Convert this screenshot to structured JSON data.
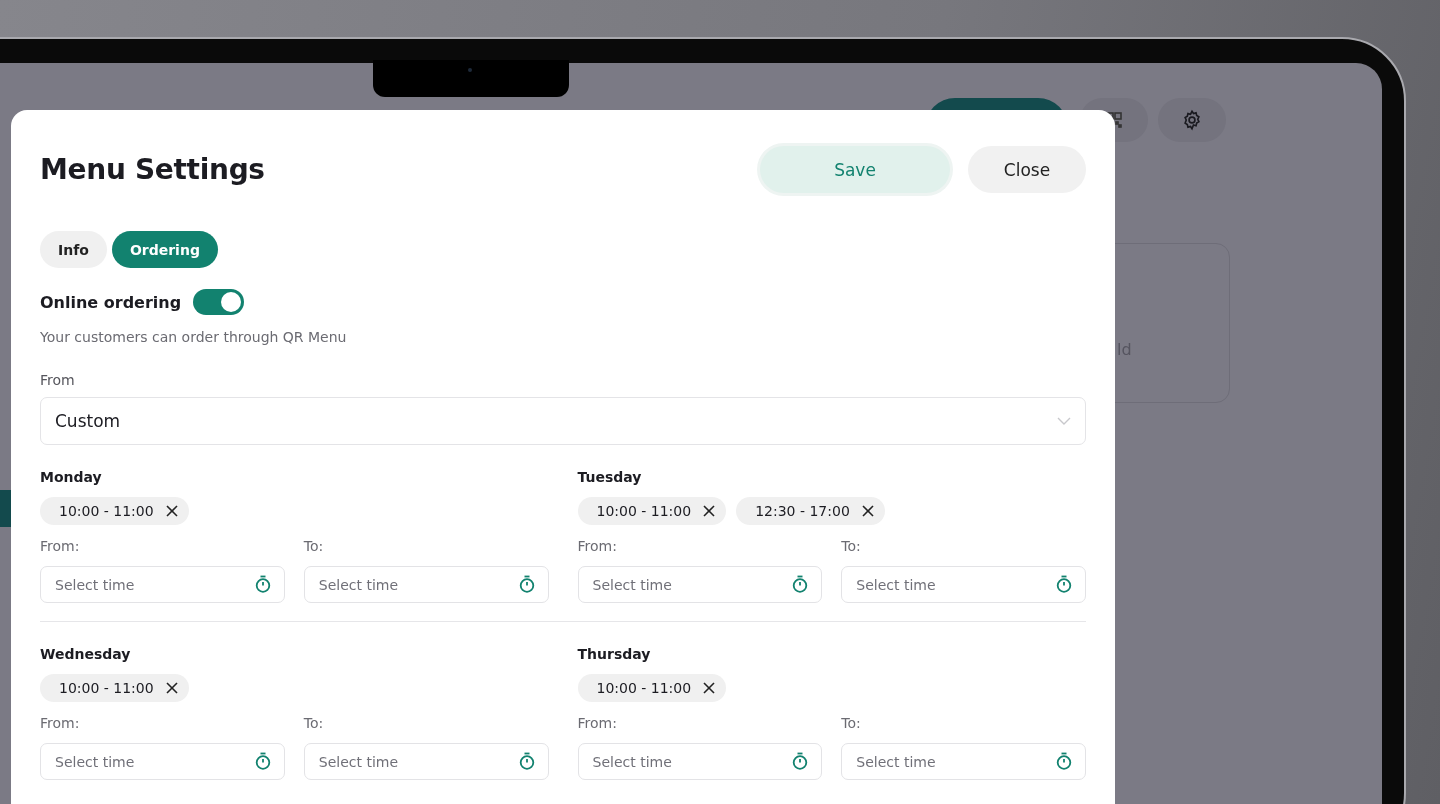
{
  "background": {
    "card_text_fragment": "ld"
  },
  "modal": {
    "title": "Menu Settings",
    "buttons": [
      {
        "label": "Save",
        "kind": "primary"
      },
      {
        "label": "Close",
        "kind": "secondary"
      }
    ],
    "tabs": [
      {
        "label": "Info",
        "selected": false
      },
      {
        "label": "Ordering",
        "selected": true
      }
    ],
    "online_ordering": {
      "label": "Online ordering",
      "on": true,
      "description": "Your customers can order through QR Menu"
    },
    "from_select": {
      "label": "From",
      "value": "Custom"
    },
    "days": [
      {
        "name": "Monday",
        "slots": [
          "10:00 - 11:00"
        ],
        "from_label": "From:",
        "to_label": "To:",
        "from_placeholder": "Select time",
        "to_placeholder": "Select time"
      },
      {
        "name": "Tuesday",
        "slots": [
          "10:00 - 11:00",
          "12:30 - 17:00"
        ],
        "from_label": "From:",
        "to_label": "To:",
        "from_placeholder": "Select time",
        "to_placeholder": "Select time"
      },
      {
        "name": "Wednesday",
        "slots": [
          "10:00 - 11:00"
        ],
        "from_label": "From:",
        "to_label": "To:",
        "from_placeholder": "Select time",
        "to_placeholder": "Select time"
      },
      {
        "name": "Thursday",
        "slots": [
          "10:00 - 11:00"
        ],
        "from_label": "From:",
        "to_label": "To:",
        "from_placeholder": "Select time",
        "to_placeholder": "Select time"
      }
    ]
  }
}
